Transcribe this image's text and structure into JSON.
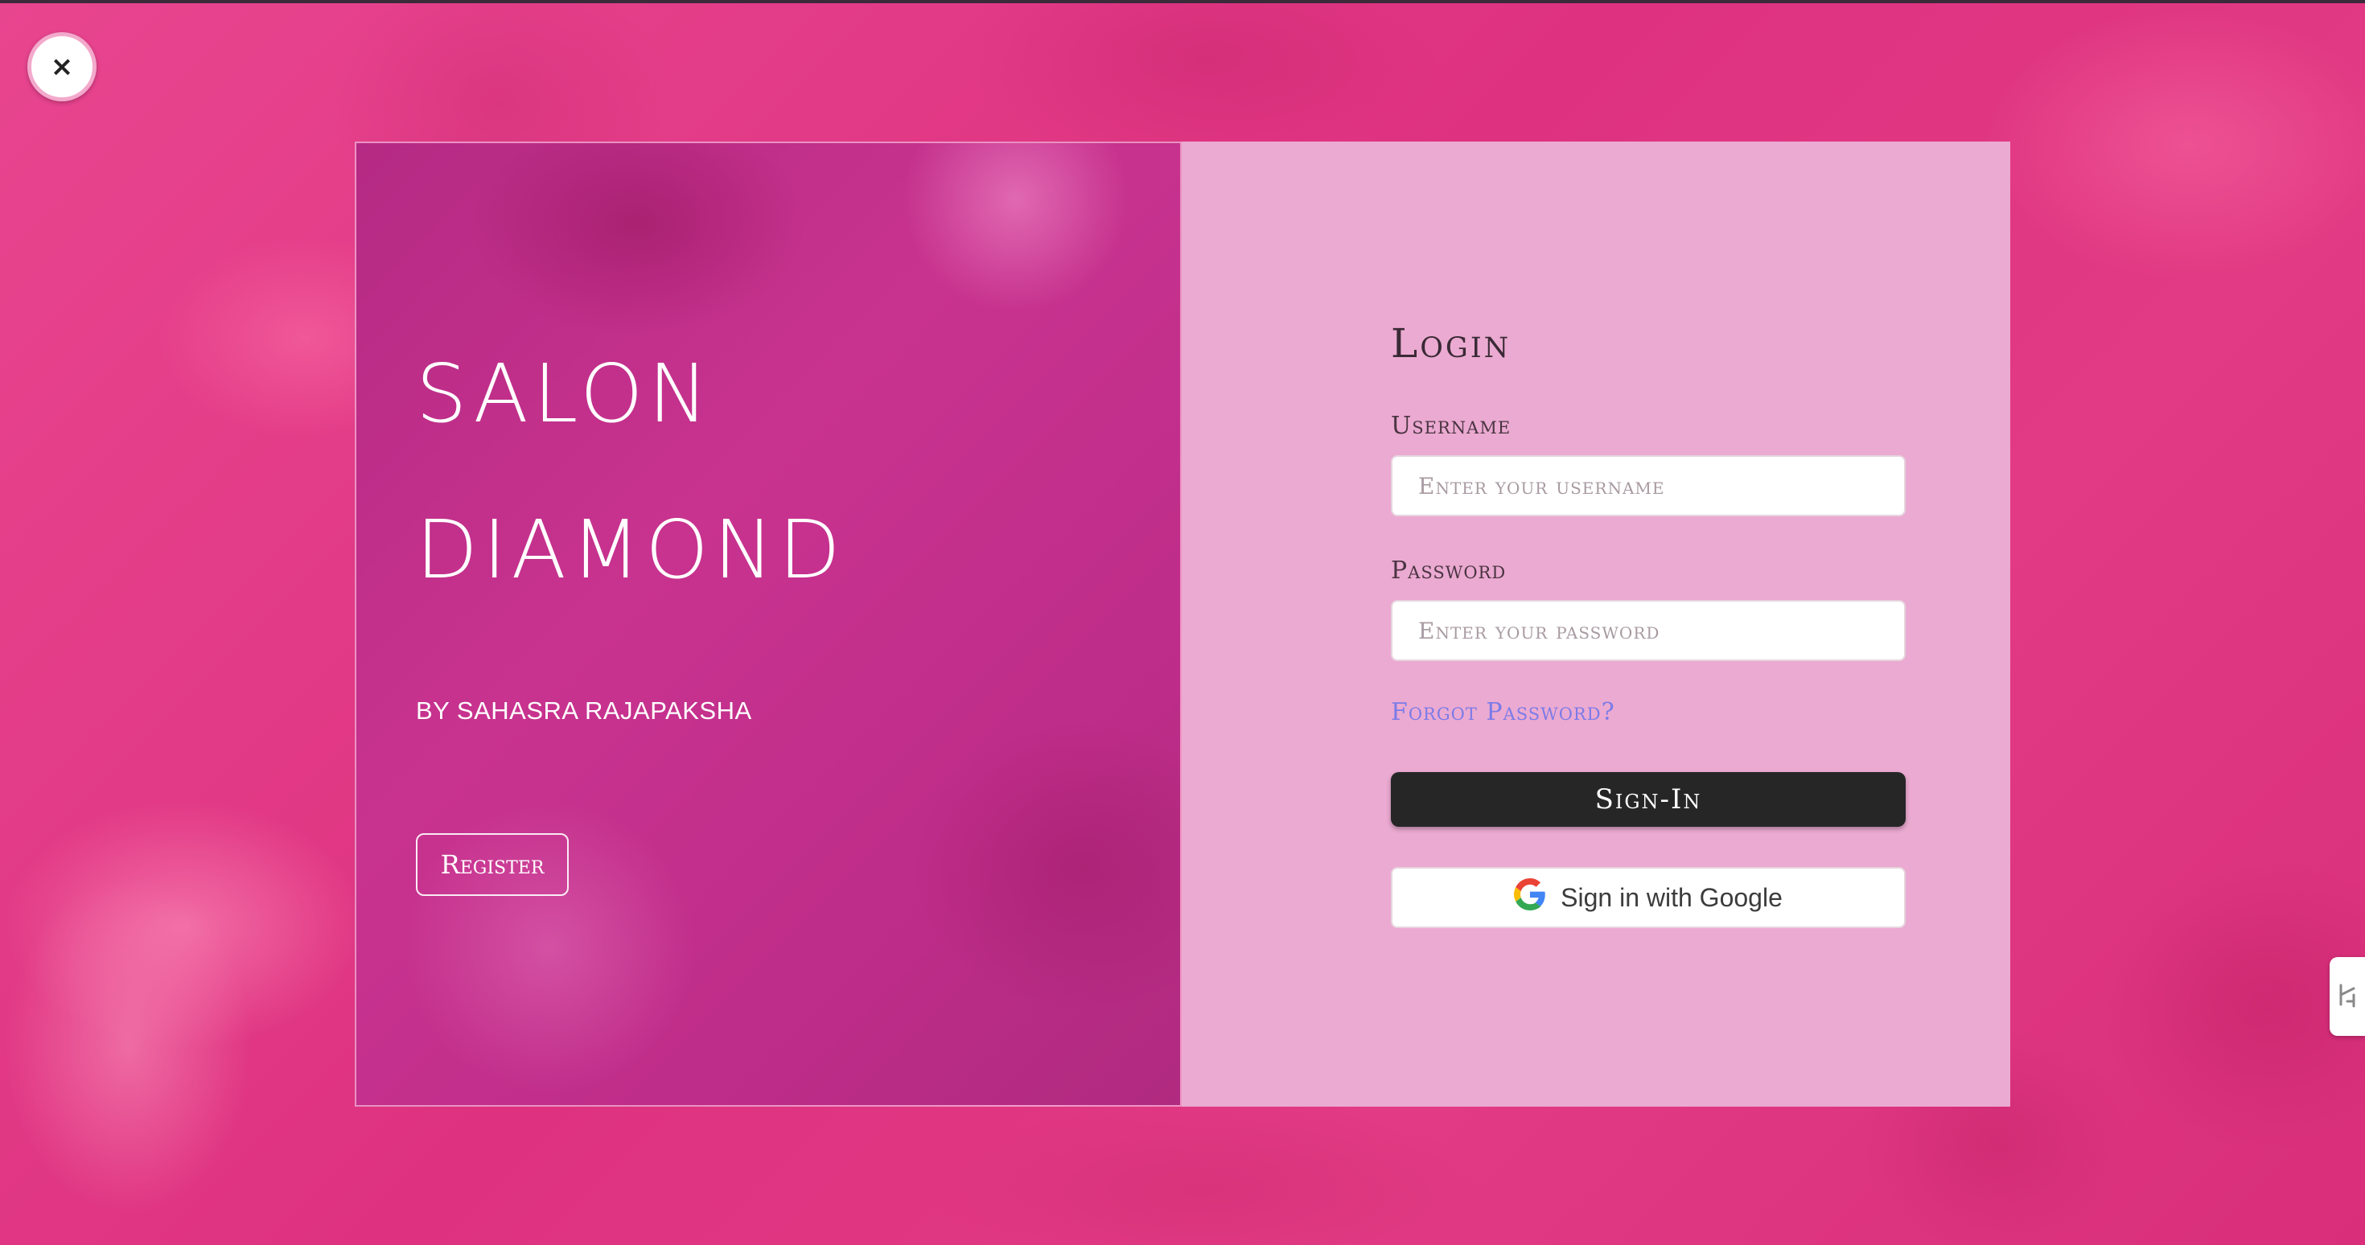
{
  "window": {
    "close_icon": "close-icon",
    "close_glyph": "×"
  },
  "brand": {
    "line1": "SALON",
    "line2": "DIAMOND",
    "byline": "BY SAHASRA RAJAPAKSHA",
    "register_label": "Register"
  },
  "login": {
    "title": "Login",
    "username_label": "Username",
    "username_placeholder": "Enter your username",
    "username_value": "",
    "password_label": "Password",
    "password_placeholder": "Enter your password",
    "password_value": "",
    "forgot_label": "Forgot Password?",
    "signin_label": "Sign-In",
    "google_label": "Sign in with Google",
    "google_icon": "google-icon"
  },
  "side_tab": {
    "icon": "extension-handle-icon"
  },
  "colors": {
    "background": "#e23a84",
    "left_panel": "#c0308b",
    "right_panel": "#ebaad1",
    "signin_button": "#262626",
    "link": "#7b7be8"
  }
}
